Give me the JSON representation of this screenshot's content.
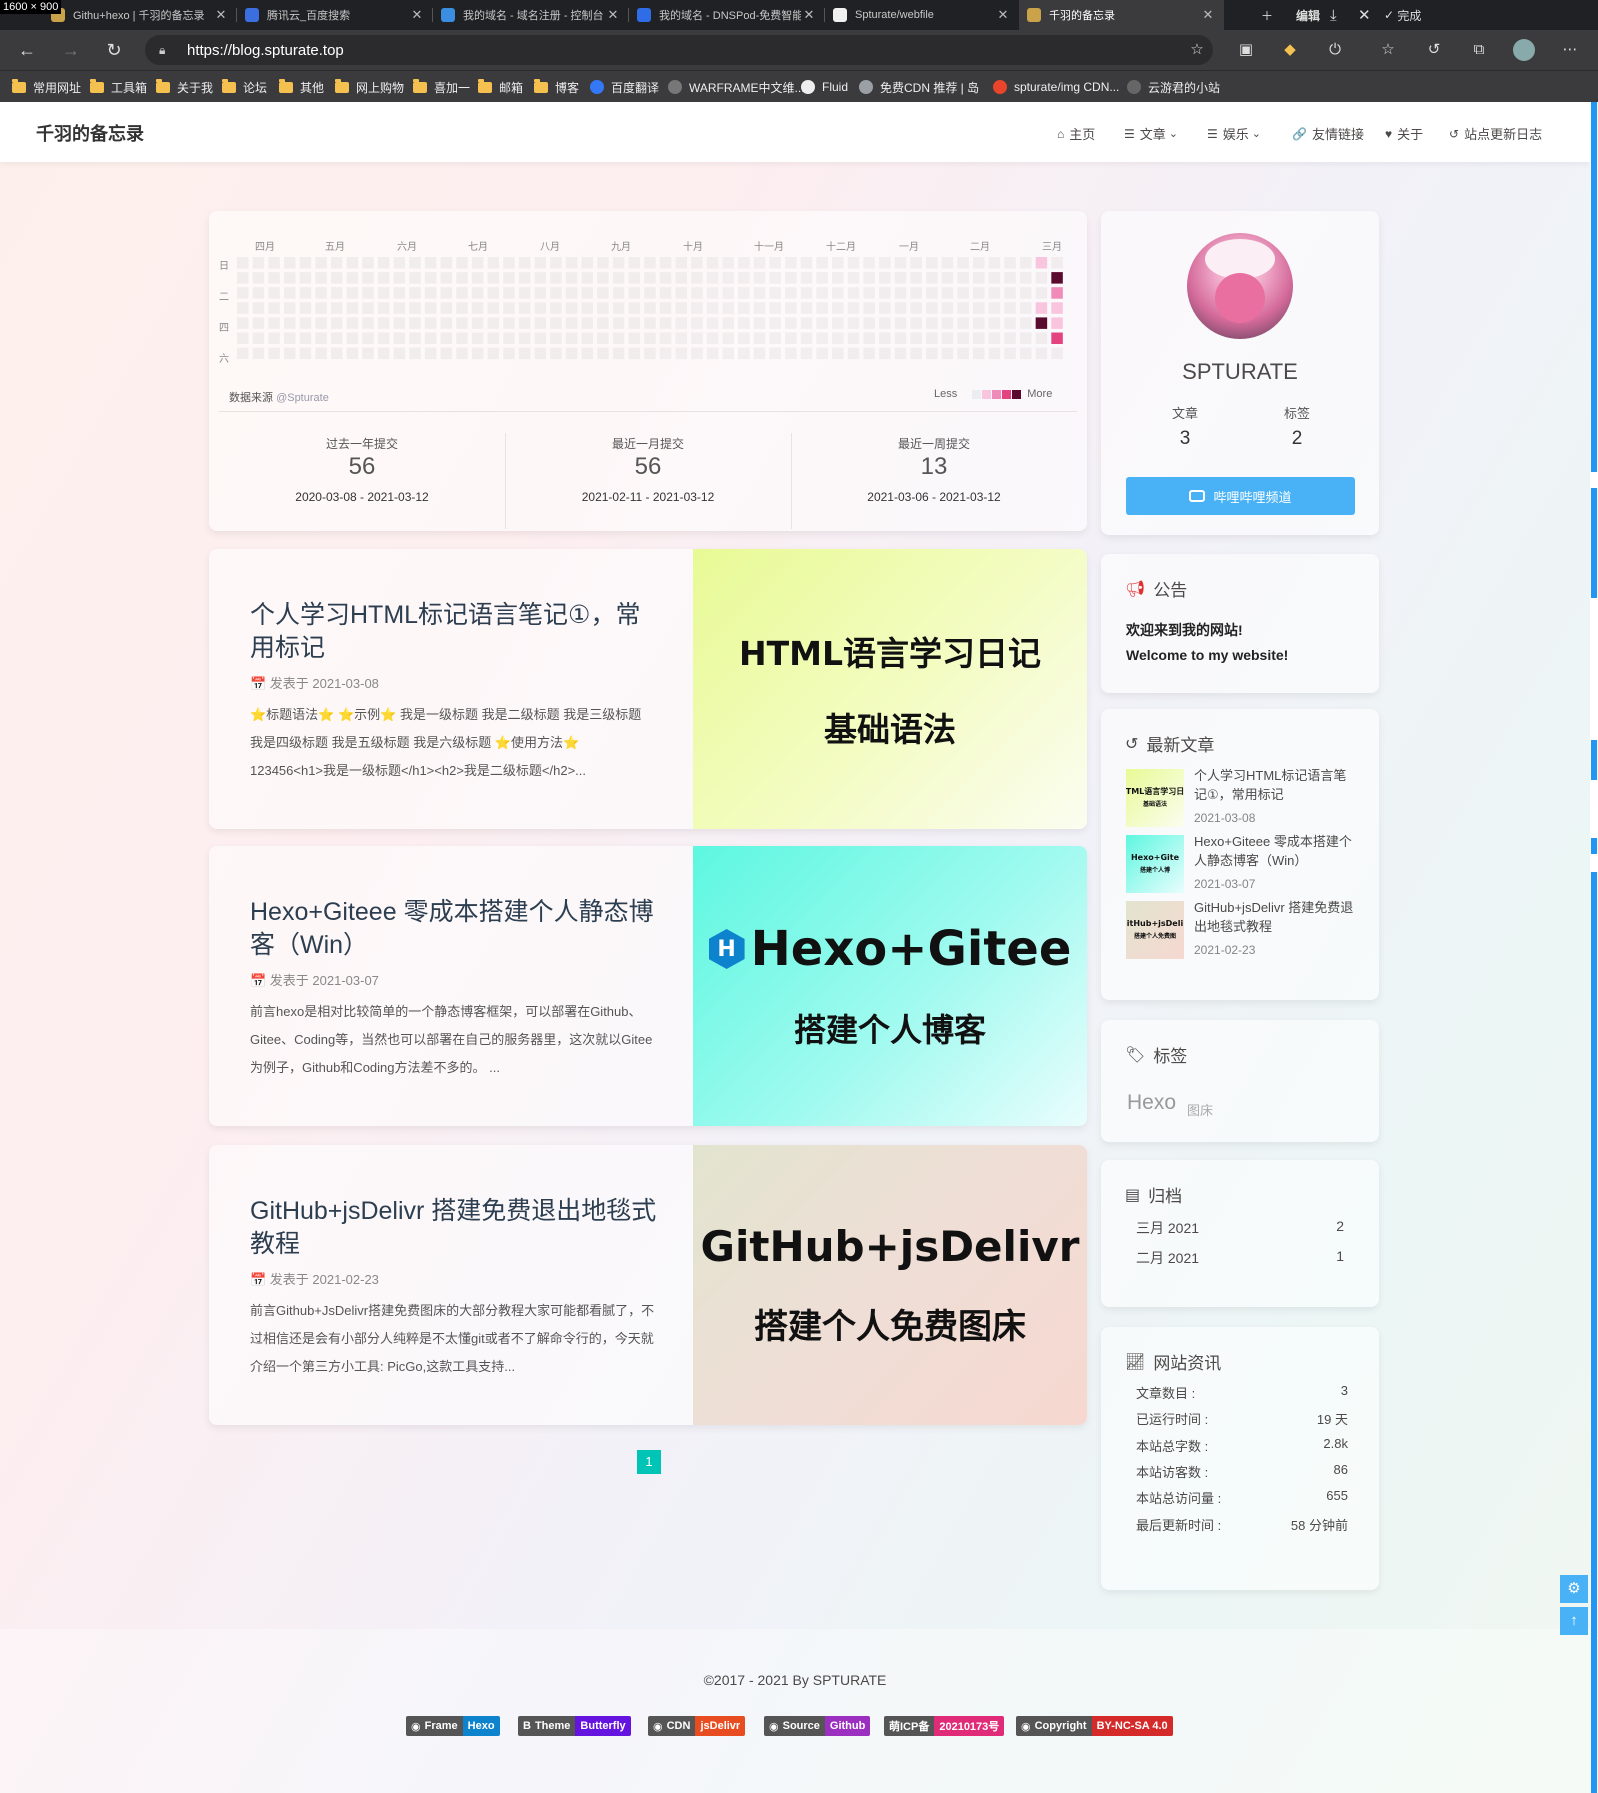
{
  "screen_label": "1600 × 900",
  "tabs": [
    {
      "title": "Githu+hexo | 千羽的备忘录",
      "favicon_color": "#c9a24a"
    },
    {
      "title": "腾讯云_百度搜索",
      "favicon_color": "#3b6fe0"
    },
    {
      "title": "我的域名 - 域名注册 - 控制台",
      "favicon_color": "#3b8de0"
    },
    {
      "title": "我的域名 - DNSPod-免费智能",
      "favicon_color": "#2f6de8"
    },
    {
      "title": "Spturate/webfile",
      "favicon_color": "#f0f0f0"
    },
    {
      "title": "千羽的备忘录",
      "favicon_color": "#c9a24a",
      "active": true
    }
  ],
  "window_controls": {
    "edit": "编辑",
    "done": "完成"
  },
  "address": {
    "url": "https://blog.spturate.top"
  },
  "bookmarks": [
    {
      "label": "常用网址",
      "type": "folder"
    },
    {
      "label": "工具箱",
      "type": "folder"
    },
    {
      "label": "关于我",
      "type": "folder"
    },
    {
      "label": "论坛",
      "type": "folder"
    },
    {
      "label": "其他",
      "type": "folder"
    },
    {
      "label": "网上购物",
      "type": "folder"
    },
    {
      "label": "喜加一",
      "type": "folder"
    },
    {
      "label": "邮箱",
      "type": "folder"
    },
    {
      "label": "博客",
      "type": "folder"
    },
    {
      "label": "百度翻译",
      "type": "site",
      "color": "#3478f6"
    },
    {
      "label": "WARFRAME中文维...",
      "type": "site",
      "color": "#777777"
    },
    {
      "label": "Fluid",
      "type": "site",
      "color": "#eeeeee"
    },
    {
      "label": "免费CDN 推荐 | 岛",
      "type": "site",
      "color": "#9aa0a6"
    },
    {
      "label": "spturate/img CDN...",
      "type": "site",
      "color": "#e8452c"
    },
    {
      "label": "云游君的小站",
      "type": "site",
      "color": "#666666"
    }
  ],
  "site": {
    "name": "千羽的备忘录",
    "menu": [
      {
        "label": "主页",
        "icon": "home-icon",
        "glyph": "⌂",
        "dropdown": false
      },
      {
        "label": "文章",
        "icon": "list-icon",
        "glyph": "☰",
        "dropdown": true
      },
      {
        "label": "娱乐",
        "icon": "list-icon",
        "glyph": "☰",
        "dropdown": true
      },
      {
        "label": "友情链接",
        "icon": "link-icon",
        "glyph": "🔗",
        "dropdown": false
      },
      {
        "label": "关于",
        "icon": "heart-icon",
        "glyph": "♥",
        "dropdown": false
      },
      {
        "label": "站点更新日志",
        "icon": "history-icon",
        "glyph": "↺",
        "dropdown": false
      }
    ]
  },
  "calendar": {
    "months": [
      "四月",
      "五月",
      "六月",
      "七月",
      "八月",
      "九月",
      "十月",
      "十一月",
      "十二月",
      "一月",
      "二月",
      "三月"
    ],
    "weekdays": [
      "日",
      "二",
      "四",
      "六"
    ],
    "source_label": "数据来源",
    "source_handle": "@Spturate",
    "legend_less": "Less",
    "legend_more": "More",
    "legend_colors": [
      "#ebedf0",
      "#f9c5de",
      "#f08ab8",
      "#e3447f",
      "#5a0a2e"
    ],
    "stats": [
      {
        "label": "过去一年提交",
        "value": "56",
        "range": "2020-03-08 - 2021-03-12"
      },
      {
        "label": "最近一月提交",
        "value": "56",
        "range": "2021-02-11 - 2021-03-12"
      },
      {
        "label": "最近一周提交",
        "value": "13",
        "range": "2021-03-06 - 2021-03-12"
      }
    ]
  },
  "posts": [
    {
      "title": "个人学习HTML标记语言笔记①，常用标记",
      "date": "📅 发表于 2021-03-08",
      "excerpt": "⭐标题语法⭐ ⭐示例⭐ 我是一级标题 我是二级标题 我是三级标题 我是四级标题 我是五级标题 我是六级标题 ⭐使用方法⭐ 123456<h1>我是一级标题</h1><h2>我是二级标题</h2>...",
      "cover_line1": "HTML语言学习日记",
      "cover_line2": "基础语法"
    },
    {
      "title": "Hexo+Giteee 零成本搭建个人静态博客（Win）",
      "date": "📅 发表于 2021-03-07",
      "excerpt": "前言hexo是相对比较简单的一个静态博客框架，可以部署在Github、Gitee、Coding等，当然也可以部署在自己的服务器里，这次就以Gitee为例子，Github和Coding方法差不多的。 ...",
      "cover_line1": "Hexo+Gitee",
      "cover_line2": "搭建个人博客"
    },
    {
      "title": "GitHub+jsDelivr 搭建免费退出地毯式教程",
      "date": "📅 发表于 2021-02-23",
      "excerpt": "前言Github+JsDelivr搭建免费图床的大部分教程大家可能都看腻了，不过相信还是会有小部分人纯粹是不太懂git或者不了解命令行的，今天就介绍一个第三方小工具: PicGo,这款工具支持...",
      "cover_line1": "GitHub+jsDelivr",
      "cover_line2": "搭建个人免费图床"
    }
  ],
  "pagination": {
    "current": "1"
  },
  "profile": {
    "author": "SPTURATE",
    "articles_label": "文章",
    "articles_value": "3",
    "tags_label": "标签",
    "tags_value": "2",
    "button_label": "哔哩哔哩频道"
  },
  "announcement": {
    "title": "公告",
    "line1": "欢迎来到我的网站!",
    "line2": "Welcome to my website!"
  },
  "recent": {
    "title": "最新文章",
    "items": [
      {
        "title": "个人学习HTML标记语言笔记①，常用标记",
        "date": "2021-03-08",
        "thumb1": "TML语言学习日",
        "thumb2": "基础语法"
      },
      {
        "title": "Hexo+Giteee 零成本搭建个人静态博客（Win）",
        "date": "2021-03-07",
        "thumb1": "Hexo+Gite",
        "thumb2": "搭建个人博"
      },
      {
        "title": "GitHub+jsDelivr 搭建免费退出地毯式教程",
        "date": "2021-02-23",
        "thumb1": "itHub+jsDeli",
        "thumb2": "搭建个人免费图"
      }
    ]
  },
  "tags": {
    "title": "标签",
    "items": [
      "Hexo",
      "图床"
    ]
  },
  "archives": {
    "title": "归档",
    "items": [
      {
        "label": "三月 2021",
        "count": "2"
      },
      {
        "label": "二月 2021",
        "count": "1"
      }
    ]
  },
  "siteinfo": {
    "title": "网站资讯",
    "items": [
      {
        "label": "文章数目 :",
        "value": "3"
      },
      {
        "label": "已运行时间 :",
        "value": "19 天"
      },
      {
        "label": "本站总字数 :",
        "value": "2.8k"
      },
      {
        "label": "本站访客数 :",
        "value": "86"
      },
      {
        "label": "本站总访问量 :",
        "value": "655"
      },
      {
        "label": "最后更新时间 :",
        "value": "58 分钟前"
      }
    ]
  },
  "footer": {
    "copyright": "©2017 - 2021 By SPTURATE",
    "badges": [
      {
        "left": "Frame",
        "right": "Hexo",
        "color": "#0e83cd",
        "icon": "◉"
      },
      {
        "left": "Theme",
        "right": "Butterfly",
        "color": "#6513df",
        "icon": "B"
      },
      {
        "left": "CDN",
        "right": "jsDelivr",
        "color": "#e84d22",
        "icon": "◉"
      },
      {
        "left": "Source",
        "right": "Github",
        "color": "#9b2fc0",
        "icon": "◉"
      },
      {
        "left": "萌ICP备",
        "right": "20210173号",
        "color": "#e02b78",
        "icon": ""
      },
      {
        "left": "Copyright",
        "right": "BY-NC-SA 4.0",
        "color": "#d42a2a",
        "icon": "◉"
      }
    ]
  }
}
